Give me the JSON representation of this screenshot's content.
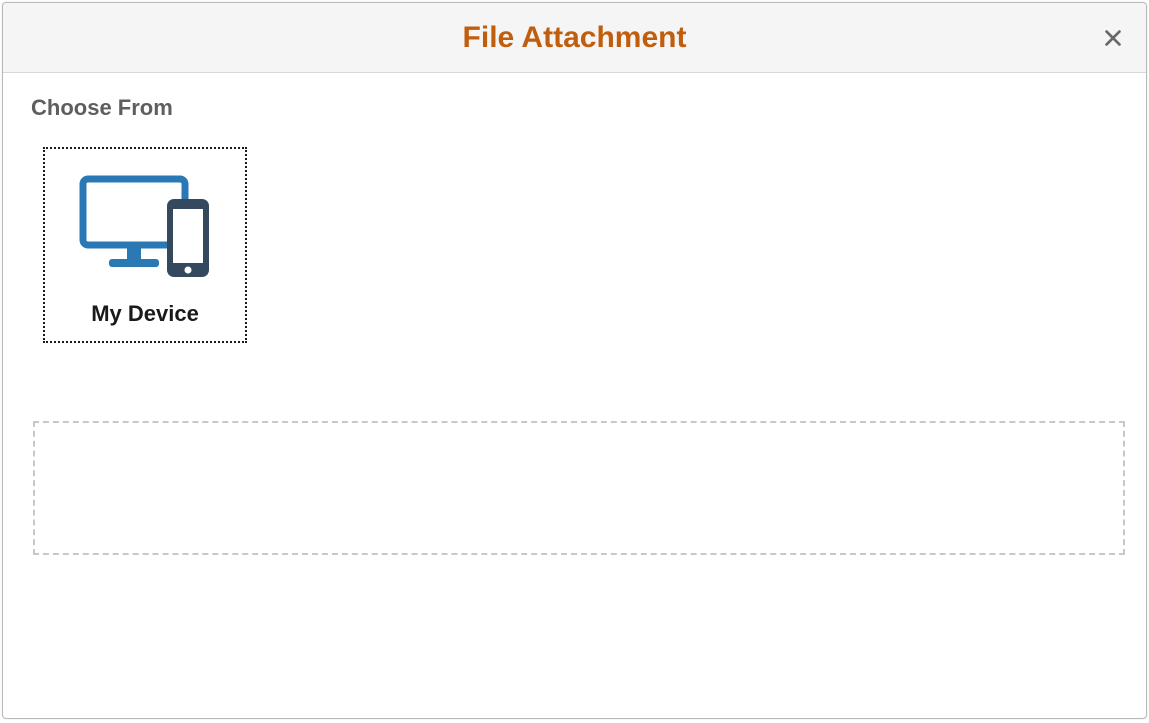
{
  "dialog": {
    "title": "File Attachment"
  },
  "section": {
    "choose_from_label": "Choose From"
  },
  "sources": {
    "my_device": {
      "label": "My Device"
    }
  }
}
